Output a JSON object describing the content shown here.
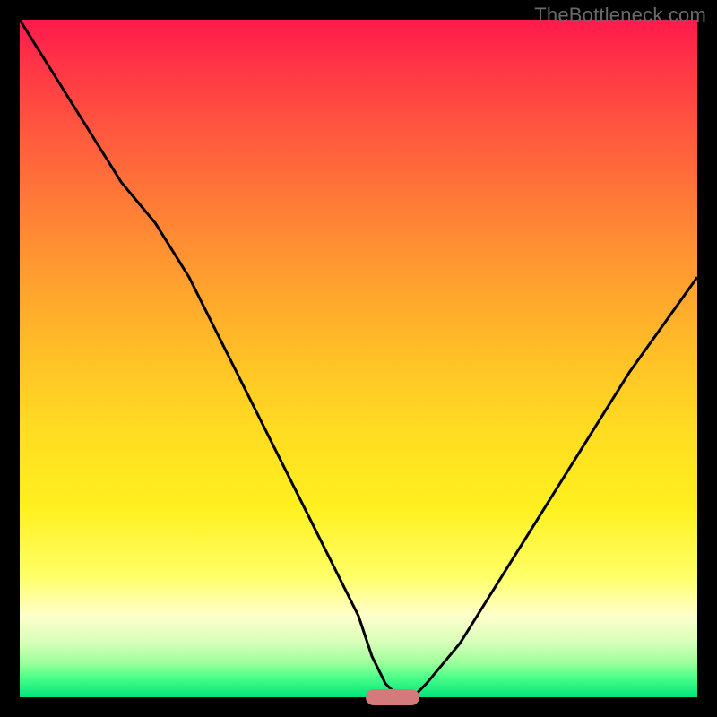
{
  "watermark": "TheBottleneck.com",
  "colors": {
    "frame": "#000000",
    "curve": "#000000",
    "marker": "#d47a7a",
    "gradient_top": "#ff1a4b",
    "gradient_bottom": "#00e57a"
  },
  "chart_data": {
    "type": "line",
    "title": "",
    "xlabel": "",
    "ylabel": "",
    "xlim": [
      0,
      100
    ],
    "ylim": [
      0,
      100
    ],
    "series": [
      {
        "name": "bottleneck-curve",
        "x": [
          0,
          5,
          10,
          15,
          20,
          25,
          30,
          35,
          40,
          45,
          50,
          52,
          54,
          56,
          58,
          60,
          65,
          70,
          75,
          80,
          85,
          90,
          95,
          100
        ],
        "values": [
          100,
          92,
          84,
          76,
          70,
          62,
          52,
          42,
          32,
          22,
          12,
          6,
          2,
          0,
          0,
          2,
          8,
          16,
          24,
          32,
          40,
          48,
          55,
          62
        ]
      }
    ],
    "marker": {
      "x": 55,
      "y": 0,
      "width_pct": 8
    }
  }
}
